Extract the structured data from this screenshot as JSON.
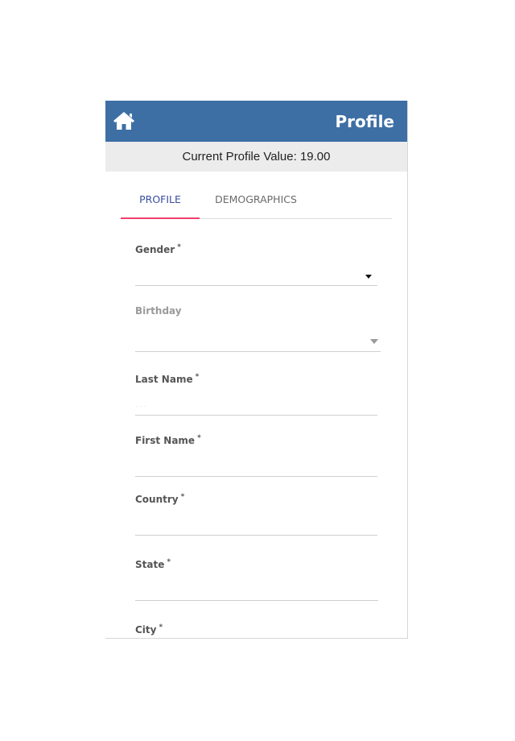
{
  "header": {
    "title": "Profile",
    "home_icon": "home-icon",
    "bar_color": "#3d6fa5"
  },
  "profile_value": {
    "text": "Current Profile Value: 19.00"
  },
  "tabs": [
    {
      "label": "PROFILE",
      "active": true,
      "accent_color": "#f0406e"
    },
    {
      "label": "DEMOGRAPHICS",
      "active": false
    }
  ],
  "form": {
    "gender": {
      "label": "Gender",
      "required_mark": "*",
      "value": ""
    },
    "birthday": {
      "label": "Birthday",
      "value": ""
    },
    "last_name": {
      "label": "Last Name",
      "required_mark": "*",
      "value": "",
      "placeholder": "· · ·"
    },
    "first_name": {
      "label": "First Name",
      "required_mark": "*",
      "value": ""
    },
    "country": {
      "label": "Country",
      "required_mark": "*",
      "value": ""
    },
    "state": {
      "label": "State",
      "required_mark": "*",
      "value": ""
    },
    "city": {
      "label": "City",
      "required_mark": "*",
      "value": ""
    }
  }
}
